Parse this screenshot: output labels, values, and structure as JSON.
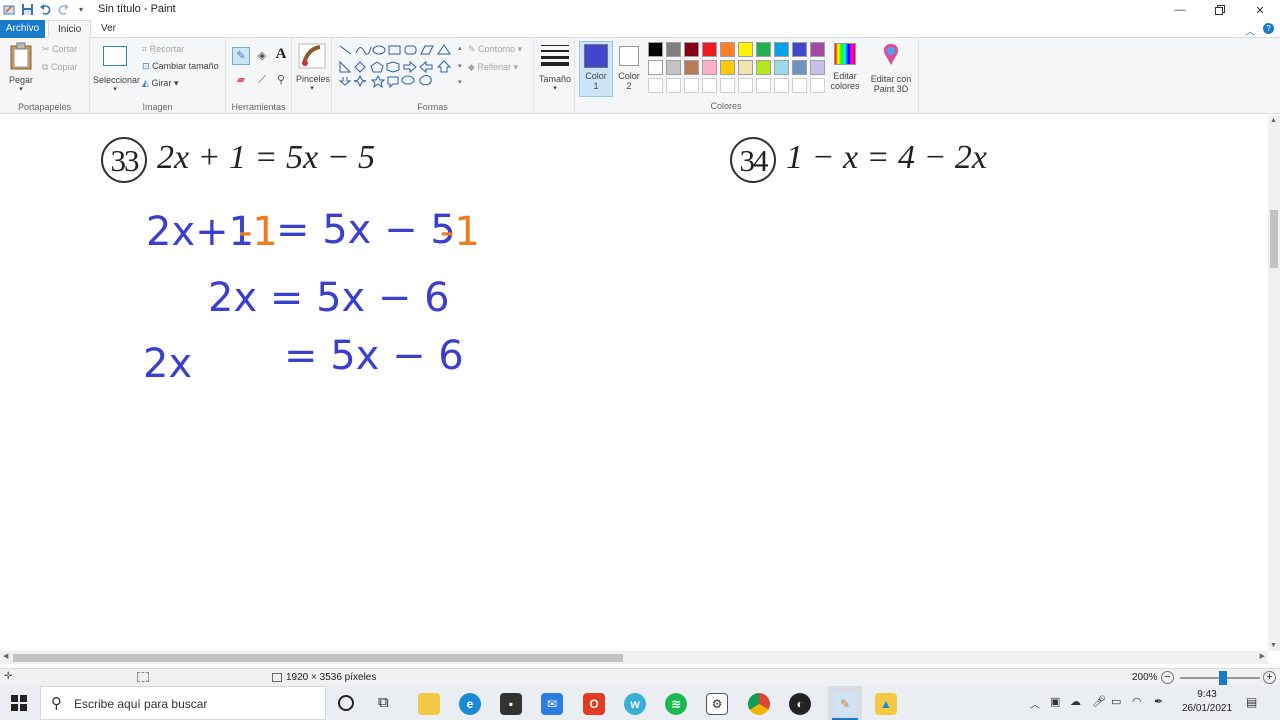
{
  "window": {
    "title": "Sin título - Paint"
  },
  "tabs": {
    "file": "Archivo",
    "home": "Inicio",
    "view": "Ver"
  },
  "ribbon": {
    "clipboard": {
      "paste": "Pegar",
      "cut": "Cortar",
      "copy": "Copiar",
      "label": "Portapapeles"
    },
    "image": {
      "select": "Seleccionar",
      "crop": "Recortar",
      "resize": "Cambiar tamaño",
      "rotate": "Girar",
      "label": "Imagen"
    },
    "tools": {
      "label": "Herramientas"
    },
    "brushes": {
      "label": "Pinceles"
    },
    "shapes": {
      "outline": "Contorno",
      "fill": "Rellenar",
      "label": "Formas"
    },
    "size": {
      "label": "Tamaño"
    },
    "color1": {
      "line1": "Color",
      "line2": "1",
      "value": "#3f48cc"
    },
    "color2": {
      "line1": "Color",
      "line2": "2",
      "value": "#ffffff"
    },
    "colors": {
      "label": "Colores",
      "edit_line1": "Editar",
      "edit_line2": "colores",
      "paint3d_line1": "Editar con",
      "paint3d_line2": "Paint 3D",
      "row1": [
        "#000000",
        "#7f7f7f",
        "#880015",
        "#ed1c24",
        "#ff7f27",
        "#fff200",
        "#22b14c",
        "#00a2e8",
        "#3f48cc",
        "#a349a4"
      ],
      "row2": [
        "#ffffff",
        "#c3c3c3",
        "#b97a57",
        "#ffaec9",
        "#ffc90e",
        "#efe4b0",
        "#b5e61d",
        "#99d9ea",
        "#7092be",
        "#c8bfe7"
      ]
    }
  },
  "canvas": {
    "problem33": {
      "number": "33",
      "equation": "2x + 1 = 5x − 5"
    },
    "problem34": {
      "number": "34",
      "equation": "1 − x = 4 − 2x"
    },
    "handwriting": {
      "line1_blue_a": "2x+1",
      "line1_orange_a": "-1",
      "line1_blue_b": "=  5x − 5",
      "line1_orange_b": "-1",
      "line2": "2x  =  5x − 6",
      "line3_left": "2x",
      "line3_right": "=  5x − 6"
    }
  },
  "status": {
    "dimensions": "1920 × 3536 píxeles",
    "zoom": "200%"
  },
  "taskbar": {
    "search_placeholder": "Escribe aquí para buscar",
    "time": "9:43",
    "date": "26/01/2021"
  }
}
